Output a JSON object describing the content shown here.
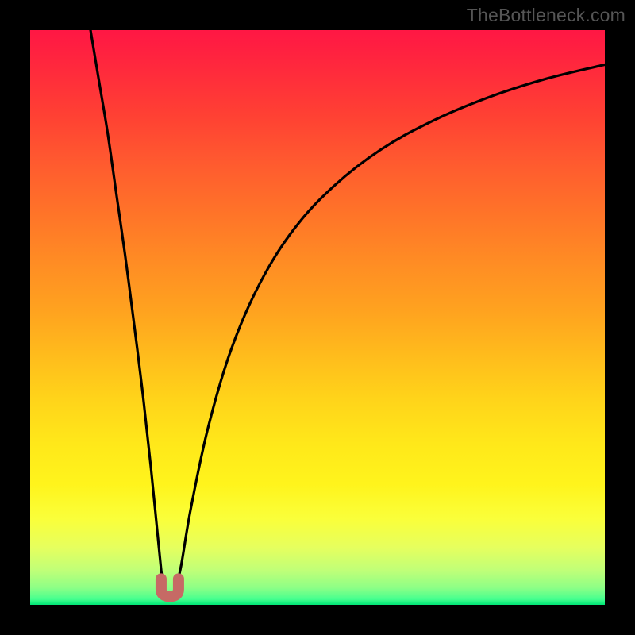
{
  "watermark": "TheBottleneck.com",
  "colors": {
    "frame": "#000000",
    "gradient_top": "#ff1744",
    "gradient_bottom": "#00e676",
    "curve": "#000000",
    "marker": "#c66a65"
  },
  "chart_data": {
    "type": "line",
    "title": "",
    "xlabel": "",
    "ylabel": "",
    "xlim": [
      0,
      100
    ],
    "ylim": [
      0,
      100
    ],
    "grid": false,
    "legend": false,
    "note": "Axes unlabeled; x and y in 0–100 image-space units (origin bottom-left). Values estimated from pixel positions.",
    "series": [
      {
        "name": "left-branch",
        "x": [
          10.5,
          12,
          13.5,
          15,
          16.5,
          18,
          19.5,
          21,
          22,
          22.8,
          23.2
        ],
        "y": [
          100,
          91,
          82,
          71.5,
          61,
          49.5,
          37.5,
          24,
          14,
          6,
          3.2
        ]
      },
      {
        "name": "right-branch",
        "x": [
          25.5,
          26.3,
          28,
          31,
          35,
          40,
          46,
          53,
          61,
          70,
          80,
          90,
          100
        ],
        "y": [
          3.5,
          7,
          17,
          31,
          44.5,
          56,
          65.5,
          73,
          79.2,
          84.2,
          88.4,
          91.6,
          94
        ]
      }
    ],
    "marker": {
      "name": "minimum-glyph",
      "shape": "u",
      "x": 24.3,
      "y": 2.3,
      "color": "#c66a65"
    }
  }
}
